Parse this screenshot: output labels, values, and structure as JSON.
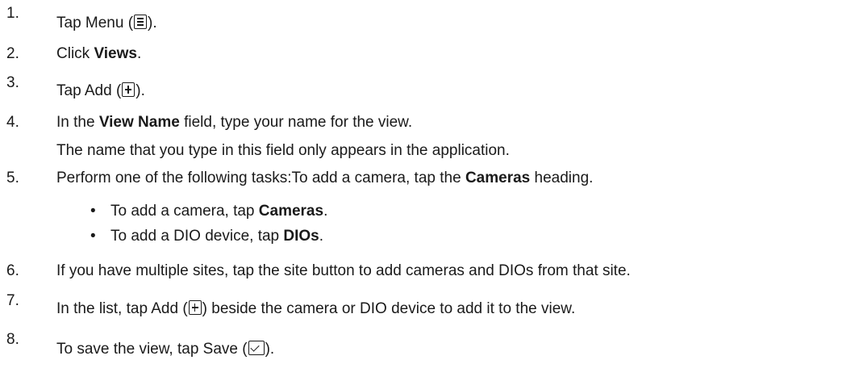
{
  "steps": [
    {
      "num": "1.",
      "pre": "Tap Menu (",
      "post": ")."
    },
    {
      "num": "2.",
      "pre": "Click ",
      "bold": "Views",
      "post": "."
    },
    {
      "num": "3.",
      "pre": "Tap Add (",
      "post": ")."
    },
    {
      "num": "4.",
      "pre": "In the ",
      "bold": "View Name",
      "post": " field, type your name for the view.",
      "note": "The name that you type in this field only appears in the application."
    },
    {
      "num": "5.",
      "pre": "Perform one of the following tasks:To add a camera, tap the ",
      "bold": "Cameras",
      "post": " heading."
    },
    {
      "num": "6.",
      "text": "If you have multiple sites, tap the site button to add cameras and DIOs from that site."
    },
    {
      "num": "7.",
      "pre": "In the list, tap Add (",
      "post": ") beside the camera or DIO device to add it to the view."
    },
    {
      "num": "8.",
      "pre": "To save the view, tap Save (",
      "post": ")."
    }
  ],
  "substeps": [
    {
      "bullet": "•",
      "pre": "To add a camera, tap ",
      "bold": "Cameras",
      "post": "."
    },
    {
      "bullet": "•",
      "pre": "To add a DIO device, tap ",
      "bold": "DIOs",
      "post": "."
    }
  ],
  "icons": {
    "menu": "menu-icon",
    "add": "plus-box-icon",
    "save": "check-box-icon"
  }
}
